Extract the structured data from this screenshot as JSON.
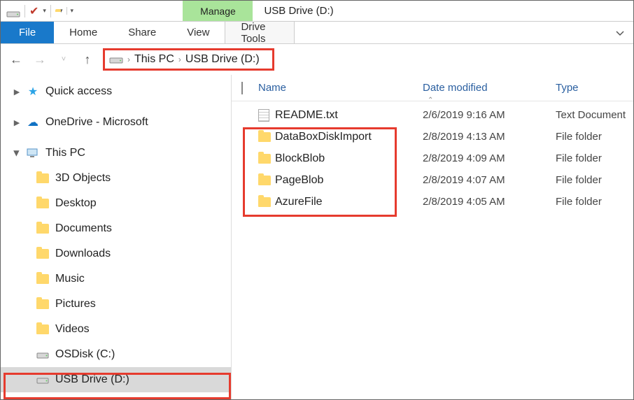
{
  "window": {
    "manage_label": "Manage",
    "title": "USB Drive (D:)"
  },
  "ribbon": {
    "file": "File",
    "home": "Home",
    "share": "Share",
    "view": "View",
    "drive_tools": "Drive Tools"
  },
  "breadcrumb": {
    "seg1": "This PC",
    "seg2": "USB Drive (D:)"
  },
  "tree": {
    "quick_access": "Quick access",
    "onedrive": "OneDrive - Microsoft",
    "this_pc": "This PC",
    "children": {
      "three_d": "3D Objects",
      "desktop": "Desktop",
      "documents": "Documents",
      "downloads": "Downloads",
      "music": "Music",
      "pictures": "Pictures",
      "videos": "Videos",
      "osdisk": "OSDisk (C:)",
      "usb": "USB Drive (D:)"
    }
  },
  "columns": {
    "name": "Name",
    "date": "Date modified",
    "type": "Type"
  },
  "rows": [
    {
      "kind": "txt",
      "name": "README.txt",
      "date": "2/6/2019 9:16 AM",
      "type": "Text Document"
    },
    {
      "kind": "folder",
      "name": "DataBoxDiskImport",
      "date": "2/8/2019 4:13 AM",
      "type": "File folder"
    },
    {
      "kind": "folder",
      "name": "BlockBlob",
      "date": "2/8/2019 4:09 AM",
      "type": "File folder"
    },
    {
      "kind": "folder",
      "name": "PageBlob",
      "date": "2/8/2019 4:07 AM",
      "type": "File folder"
    },
    {
      "kind": "folder",
      "name": "AzureFile",
      "date": "2/8/2019 4:05 AM",
      "type": "File folder"
    }
  ]
}
